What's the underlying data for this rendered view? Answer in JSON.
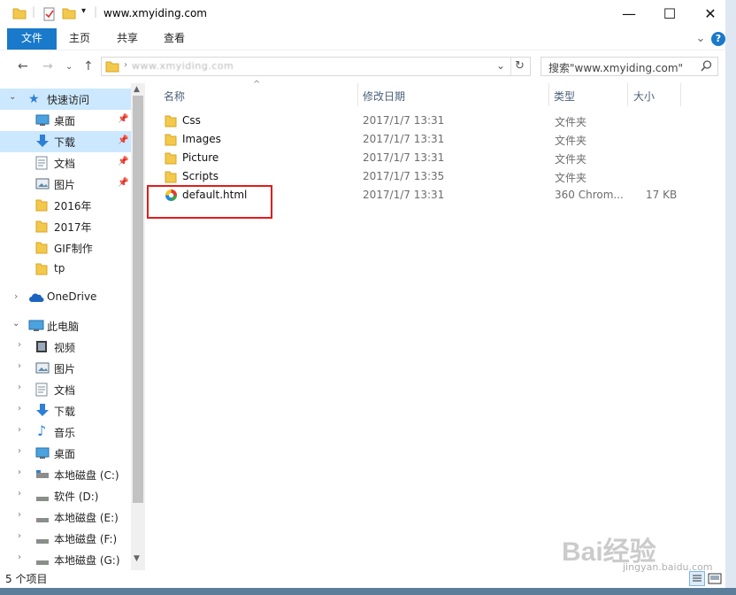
{
  "window": {
    "title": "www.xmyiding.com",
    "minimize_glyph": "—",
    "maximize_glyph": "☐",
    "close_glyph": "✕"
  },
  "ribbon": {
    "tabs": [
      "文件",
      "主页",
      "共享",
      "查看"
    ],
    "help_glyph": "?",
    "expand_glyph": "⌄"
  },
  "address": {
    "path_text": "www.xmyiding.com",
    "refresh_glyph": "↻",
    "dropdown_glyph": "⌄"
  },
  "search": {
    "placeholder": "搜索\"www.xmyiding.com\"",
    "icon": "search-icon"
  },
  "nav": {
    "quick_access": {
      "label": "快速访问",
      "items": [
        {
          "label": "桌面",
          "icon": "desktop-icon",
          "pinned": true
        },
        {
          "label": "下载",
          "icon": "download-icon",
          "pinned": true
        },
        {
          "label": "文档",
          "icon": "document-icon",
          "pinned": true
        },
        {
          "label": "图片",
          "icon": "picture-icon",
          "pinned": true
        },
        {
          "label": "2016年",
          "icon": "folder-icon"
        },
        {
          "label": "2017年",
          "icon": "folder-icon"
        },
        {
          "label": "GIF制作",
          "icon": "folder-icon"
        },
        {
          "label": "tp",
          "icon": "folder-icon"
        }
      ]
    },
    "onedrive": {
      "label": "OneDrive"
    },
    "this_pc": {
      "label": "此电脑",
      "items": [
        {
          "label": "视频",
          "icon": "video-icon"
        },
        {
          "label": "图片",
          "icon": "picture-icon"
        },
        {
          "label": "文档",
          "icon": "document-icon"
        },
        {
          "label": "下载",
          "icon": "download-icon"
        },
        {
          "label": "音乐",
          "icon": "music-icon"
        },
        {
          "label": "桌面",
          "icon": "desktop-icon"
        },
        {
          "label": "本地磁盘 (C:)",
          "icon": "drive-icon"
        },
        {
          "label": "软件 (D:)",
          "icon": "drive-icon"
        },
        {
          "label": "本地磁盘 (E:)",
          "icon": "drive-icon"
        },
        {
          "label": "本地磁盘 (F:)",
          "icon": "drive-icon"
        },
        {
          "label": "本地磁盘 (G:)",
          "icon": "drive-icon"
        }
      ]
    }
  },
  "files": {
    "columns": [
      "名称",
      "修改日期",
      "类型",
      "大小"
    ],
    "rows": [
      {
        "name": "Css",
        "date": "2017/1/7 13:31",
        "type": "文件夹",
        "size": "",
        "icon": "folder-icon"
      },
      {
        "name": "Images",
        "date": "2017/1/7 13:31",
        "type": "文件夹",
        "size": "",
        "icon": "folder-icon"
      },
      {
        "name": "Picture",
        "date": "2017/1/7 13:31",
        "type": "文件夹",
        "size": "",
        "icon": "folder-icon"
      },
      {
        "name": "Scripts",
        "date": "2017/1/7 13:35",
        "type": "文件夹",
        "size": "",
        "icon": "folder-icon"
      },
      {
        "name": "default.html",
        "date": "2017/1/7 13:31",
        "type": "360 Chrom...",
        "size": "17 KB",
        "icon": "browser-html-icon"
      }
    ]
  },
  "status": {
    "text": "5 个项目"
  },
  "watermark": {
    "text": "Bai经验",
    "sub": "jingyan.baidu.com"
  },
  "colors": {
    "accent": "#1979ca",
    "selection": "#cce8ff",
    "highlight_box": "#e31b1b",
    "folder": "#f2c94c"
  }
}
